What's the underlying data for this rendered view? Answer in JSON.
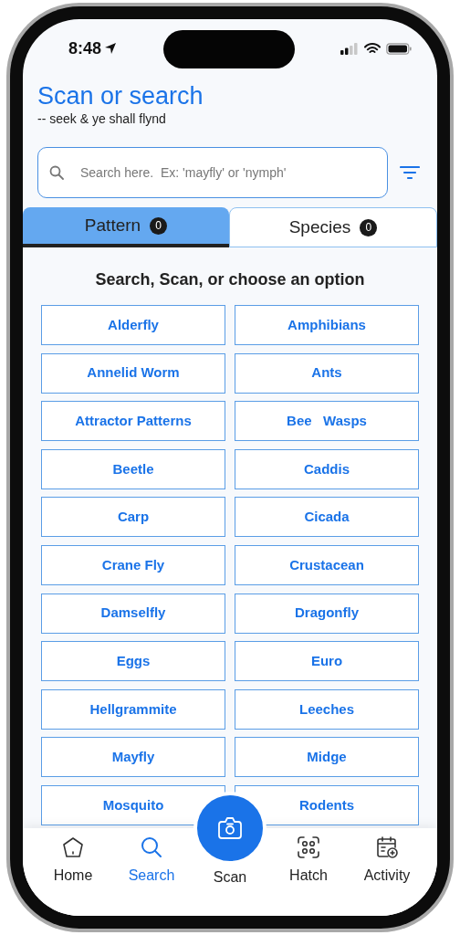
{
  "status_bar": {
    "time": "8:48"
  },
  "header": {
    "title": "Scan or search",
    "subtitle": "-- seek & ye shall flynd"
  },
  "search": {
    "placeholder": "Search here.  Ex: 'mayfly' or 'nymph'"
  },
  "tabs": [
    {
      "label": "Pattern",
      "count": "0",
      "selected": true
    },
    {
      "label": "Species",
      "count": "0",
      "selected": false
    }
  ],
  "heading": "Search, Scan, or choose an option",
  "options": [
    "Alderfly",
    "Amphibians",
    "Annelid Worm",
    "Ants",
    "Attractor Patterns",
    "Bee   Wasps",
    "Beetle",
    "Caddis",
    "Carp",
    "Cicada",
    "Crane Fly",
    "Crustacean",
    "Damselfly",
    "Dragonfly",
    "Eggs",
    "Euro",
    "Hellgrammite",
    "Leeches",
    "Mayfly",
    "Midge",
    "Mosquito",
    "Rodents"
  ],
  "nav": [
    {
      "kind": "home",
      "label": "Home",
      "selected": false
    },
    {
      "kind": "search",
      "label": "Search",
      "selected": true
    },
    {
      "kind": "scan",
      "label": "Scan",
      "selected": false
    },
    {
      "kind": "hatch",
      "label": "Hatch",
      "selected": false
    },
    {
      "kind": "activity",
      "label": "Activity",
      "selected": false
    }
  ]
}
